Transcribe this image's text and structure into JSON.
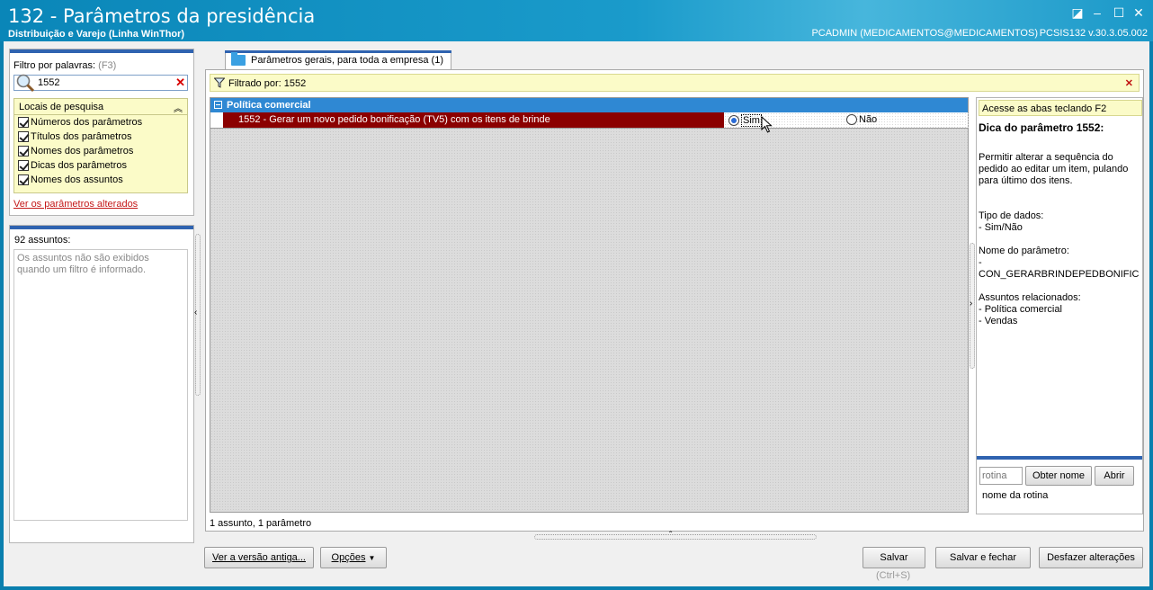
{
  "window": {
    "title": "132 - Parâmetros da presidência",
    "subtitle": "Distribuição e Varejo (Linha WinThor)",
    "user": "PCADMIN (MEDICAMENTOS@MEDICAMENTOS)",
    "version": "PCSIS132  v.30.3.05.002"
  },
  "filter": {
    "label": "Filtro por palavras:",
    "shortcut": "(F3)",
    "value": "1552"
  },
  "locais": {
    "title": "Locais de pesquisa",
    "items": [
      "Números dos parâmetros",
      "Títulos dos parâmetros",
      "Nomes dos parâmetros",
      "Dicas dos parâmetros",
      "Nomes dos assuntos"
    ]
  },
  "link_alterados": "Ver os parâmetros alterados",
  "assuntos": {
    "count_label": "92 assuntos:",
    "message": "Os assuntos não são exibidos quando um filtro é informado."
  },
  "tab": {
    "label": "Parâmetros gerais, para toda a empresa  (1)"
  },
  "filtered_by": "Filtrado por: 1552",
  "grid": {
    "group": "Política comercial",
    "row": {
      "name": "1552 - Gerar um  novo pedido bonificação (TV5) com os itens de brinde",
      "opt_yes": "Sim",
      "opt_no": "Não",
      "selected": "Sim"
    }
  },
  "status": "1 assunto, 1 parâmetro",
  "tips": {
    "acesse": "Acesse as abas teclando F2",
    "title": "Dica do parâmetro 1552:",
    "text": "Permitir alterar a sequência do pedido ao editar um item, pulando para último dos itens.\n\n\nTipo de dados:\n   - Sim/Não\n\nNome do parâmetro:\n   - CON_GERARBRINDEPEDBONIFIC\n\nAssuntos relacionados:\n   - Política comercial\n   - Vendas"
  },
  "rotina": {
    "placeholder": "rotina",
    "obter": "Obter nome",
    "abrir": "Abrir",
    "hint": "nome da rotina"
  },
  "buttons": {
    "versao": "Ver a versão antiga...",
    "opcoes": "Opções",
    "salvar": "Salvar",
    "salvar_hint": "(Ctrl+S)",
    "salvar_fechar": "Salvar e fechar",
    "desfazer": "Desfazer alterações"
  }
}
